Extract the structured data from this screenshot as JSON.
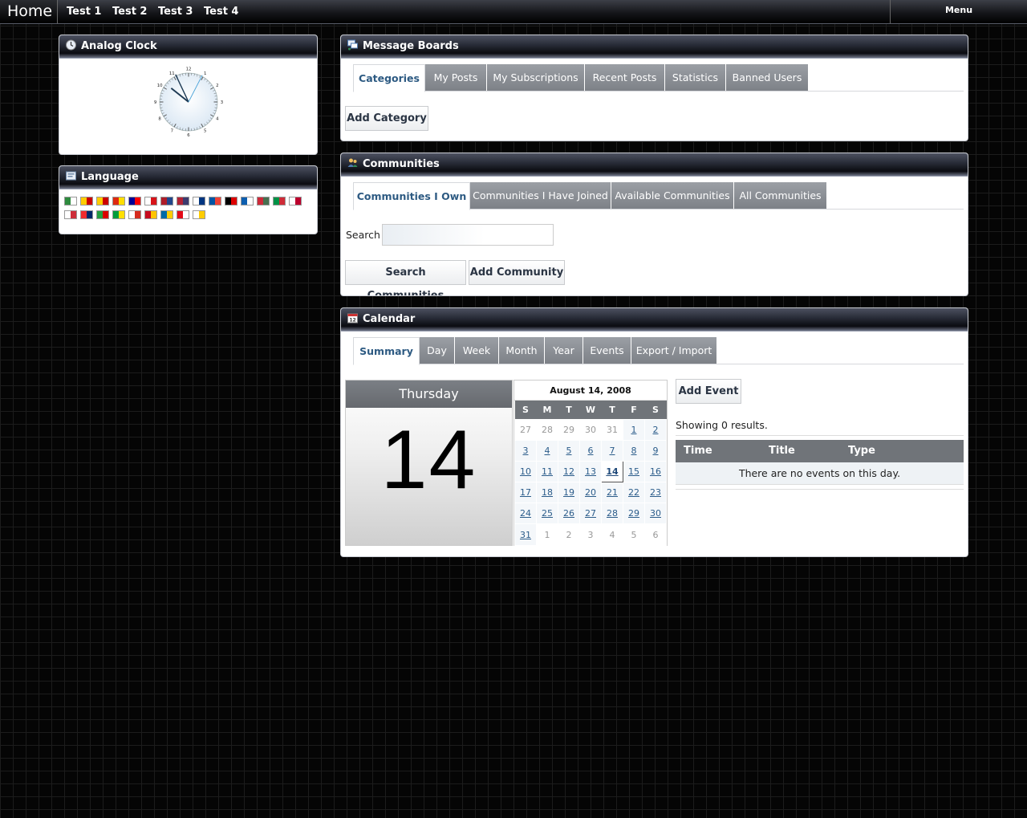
{
  "nav": {
    "home": "Home",
    "links": [
      "Test 1",
      "Test 2",
      "Test 3",
      "Test 4"
    ],
    "menu": "Menu"
  },
  "clock_portlet": {
    "title": "Analog Clock",
    "numerals": [
      "12",
      "1",
      "2",
      "3",
      "4",
      "5",
      "6",
      "7",
      "8",
      "9",
      "10",
      "11"
    ]
  },
  "language_portlet": {
    "title": "Language",
    "flags": [
      "Arabic",
      "Catalan",
      "Catalan (alt)",
      "Chinese (Simplified)",
      "Chinese (Traditional)",
      "Czech",
      "Dutch",
      "English",
      "Finnish",
      "French",
      "German",
      "Greek",
      "Hungarian",
      "Italian",
      "Japanese",
      "Korean",
      "Norwegian",
      "Persian",
      "Portuguese",
      "Russian",
      "Spanish",
      "Swedish",
      "Turkish",
      "Vietnamese"
    ]
  },
  "message_boards": {
    "title": "Message Boards",
    "tabs": [
      "Categories",
      "My Posts",
      "My Subscriptions",
      "Recent Posts",
      "Statistics",
      "Banned Users"
    ],
    "add_category": "Add Category"
  },
  "communities": {
    "title": "Communities",
    "tabs": [
      "Communities I Own",
      "Communities I Have Joined",
      "Available Communities",
      "All Communities"
    ],
    "search_label": "Search",
    "search_value": "",
    "search_button": "Search Communities",
    "add_button": "Add Community"
  },
  "calendar": {
    "title": "Calendar",
    "tabs": [
      "Summary",
      "Day",
      "Week",
      "Month",
      "Year",
      "Events",
      "Export / Import"
    ],
    "weekday": "Thursday",
    "day": "14",
    "month_title": "August 14, 2008",
    "dow": [
      "S",
      "M",
      "T",
      "W",
      "T",
      "F",
      "S"
    ],
    "weeks": [
      [
        "27",
        "28",
        "29",
        "30",
        "31",
        "1",
        "2"
      ],
      [
        "3",
        "4",
        "5",
        "6",
        "7",
        "8",
        "9"
      ],
      [
        "10",
        "11",
        "12",
        "13",
        "14",
        "15",
        "16"
      ],
      [
        "17",
        "18",
        "19",
        "20",
        "21",
        "22",
        "23"
      ],
      [
        "24",
        "25",
        "26",
        "27",
        "28",
        "29",
        "30"
      ],
      [
        "31",
        "1",
        "2",
        "3",
        "4",
        "5",
        "6"
      ]
    ],
    "add_event": "Add Event",
    "results": "Showing 0 results.",
    "columns": [
      "Time",
      "Title",
      "Type"
    ],
    "empty": "There are no events on this day."
  }
}
